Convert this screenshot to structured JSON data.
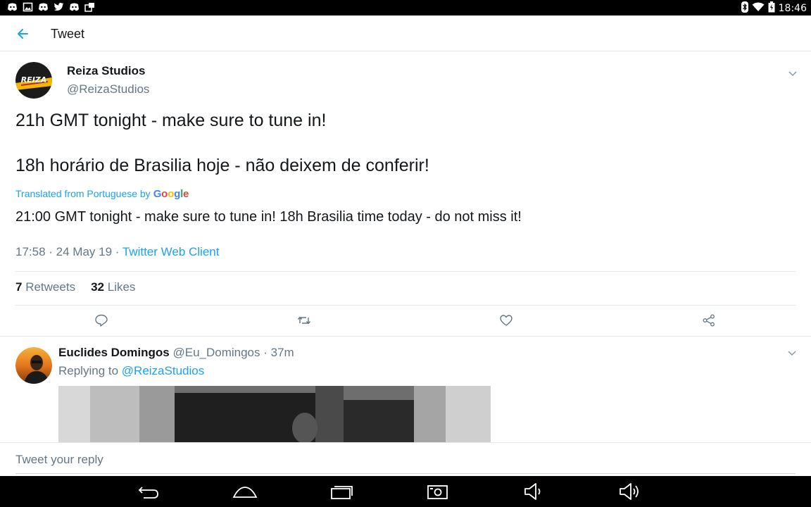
{
  "status_bar": {
    "left_icons": [
      "discord-icon",
      "image-icon",
      "discord-icon",
      "twitter-icon",
      "discord-icon",
      "app-icon"
    ],
    "right_icons": [
      "bluetooth-icon",
      "wifi-icon",
      "battery-icon"
    ],
    "time": "18:46"
  },
  "header": {
    "title": "Tweet"
  },
  "tweet": {
    "author_name": "Reiza Studios",
    "author_handle": "@ReizaStudios",
    "avatar_text": "REIZA",
    "line1": "21h GMT tonight - make sure to tune in!",
    "line2": "18h horário de Brasilia hoje - não deixem de conferir!",
    "translated_label": "Translated from Portuguese by",
    "translator": "Google",
    "translation": "21:00 GMT tonight - make sure to tune in! 18h Brasilia time today - do not miss it!",
    "timestamp": "17:58 · 24 May 19 · ",
    "source": "Twitter Web Client",
    "retweets_count": "7",
    "retweets_label": "Retweets",
    "likes_count": "32",
    "likes_label": "Likes"
  },
  "reply": {
    "author_name": "Euclides Domingos",
    "meta": " @Eu_Domingos · 37m",
    "replying_label": "Replying to ",
    "replying_handle": "@ReizaStudios"
  },
  "compose": {
    "placeholder": "Tweet your reply"
  },
  "colors": {
    "accent": "#1da1f2",
    "secondary_text": "#657786",
    "primary_text": "#14171a",
    "divider": "#e1e8ed"
  }
}
